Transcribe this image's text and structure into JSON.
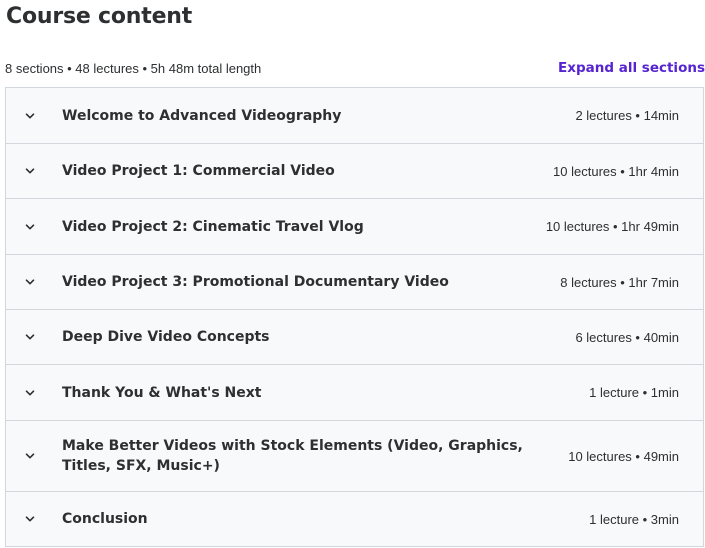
{
  "header": {
    "title": "Course content",
    "summary": "8 sections • 48 lectures • 5h 48m total length",
    "expand_label": "Expand all sections"
  },
  "sections": [
    {
      "title": "Welcome to Advanced Videography",
      "info": "2 lectures • 14min"
    },
    {
      "title": "Video Project 1: Commercial Video",
      "info": "10 lectures • 1hr 4min"
    },
    {
      "title": "Video Project 2: Cinematic Travel Vlog",
      "info": "10 lectures • 1hr 49min"
    },
    {
      "title": "Video Project 3: Promotional Documentary Video",
      "info": "8 lectures • 1hr 7min"
    },
    {
      "title": "Deep Dive Video Concepts",
      "info": "6 lectures • 40min"
    },
    {
      "title": "Thank You & What's Next",
      "info": "1 lecture • 1min"
    },
    {
      "title": "Make Better Videos with Stock Elements (Video, Graphics, Titles, SFX, Music+)",
      "info": "10 lectures • 49min"
    },
    {
      "title": "Conclusion",
      "info": "1 lecture • 3min"
    }
  ],
  "icons": {
    "section_toggle": "chevron-down-icon"
  },
  "colors": {
    "accent": "#5624d0",
    "section_bg": "#f7f9fa",
    "border": "#d1d7dc",
    "text": "#2d2f31"
  }
}
